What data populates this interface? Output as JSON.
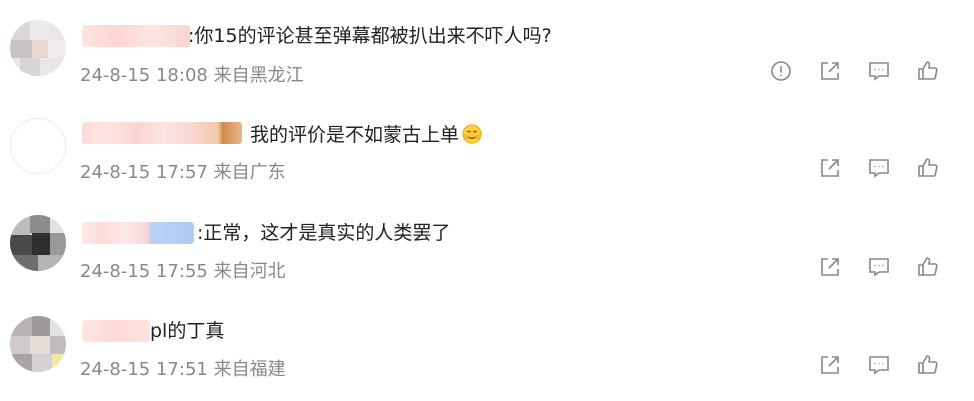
{
  "comments": [
    {
      "text": ":你15的评论甚至弹幕都被扒出来不吓人吗?",
      "date": "24-8-15 18:08",
      "location": "来自黑龙江",
      "has_report": true
    },
    {
      "text": "我的评价是不如蒙古上单",
      "emoji": "smiling-face-emoji",
      "date": "24-8-15 17:57",
      "location": "来自广东",
      "has_report": false
    },
    {
      "text": ":正常，这才是真实的人类罢了",
      "date": "24-8-15 17:55",
      "location": "来自河北",
      "has_report": false
    },
    {
      "text": "pl的丁真",
      "date": "24-8-15 17:51",
      "location": "来自福建",
      "has_report": false
    }
  ],
  "icons": {
    "report": "exclamation-circle-icon",
    "share": "share-icon",
    "reply": "comment-icon",
    "like": "thumbs-up-icon"
  },
  "colors": {
    "text": "#222222",
    "meta": "#888888",
    "icon": "#888888"
  }
}
